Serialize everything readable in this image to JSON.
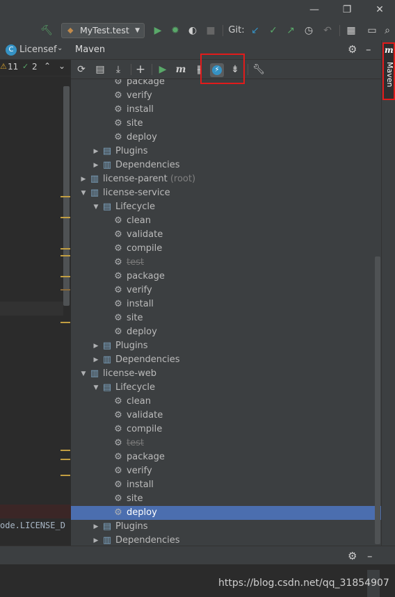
{
  "toolbar": {
    "run_config": "MyTest.test",
    "git_label": "Git:"
  },
  "editor_tab": {
    "label": "Licensef",
    "warnings": "11",
    "weak": "2"
  },
  "editor": {
    "code_fragment": "ode.LICENSE_D"
  },
  "maven": {
    "title": "Maven",
    "side_tab": "Maven",
    "tree": [
      {
        "label": "package",
        "type": "goal",
        "level": 3
      },
      {
        "label": "verify",
        "type": "goal",
        "level": 3
      },
      {
        "label": "install",
        "type": "goal",
        "level": 3
      },
      {
        "label": "site",
        "type": "goal",
        "level": 3
      },
      {
        "label": "deploy",
        "type": "goal",
        "level": 3
      },
      {
        "label": "Plugins",
        "type": "plugins",
        "level": 2
      },
      {
        "label": "Dependencies",
        "type": "deps",
        "level": 2
      },
      {
        "label": "license-parent",
        "suffix": " (root)",
        "type": "project",
        "level": 1
      },
      {
        "label": "license-service",
        "type": "project-open",
        "level": 1
      },
      {
        "label": "Lifecycle",
        "type": "lifecycle",
        "level": 2
      },
      {
        "label": "clean",
        "type": "goal",
        "level": 3
      },
      {
        "label": "validate",
        "type": "goal",
        "level": 3
      },
      {
        "label": "compile",
        "type": "goal",
        "level": 3
      },
      {
        "label": "test",
        "type": "goal-skip",
        "level": 3
      },
      {
        "label": "package",
        "type": "goal",
        "level": 3
      },
      {
        "label": "verify",
        "type": "goal",
        "level": 3
      },
      {
        "label": "install",
        "type": "goal",
        "level": 3
      },
      {
        "label": "site",
        "type": "goal",
        "level": 3
      },
      {
        "label": "deploy",
        "type": "goal",
        "level": 3
      },
      {
        "label": "Plugins",
        "type": "plugins",
        "level": 2
      },
      {
        "label": "Dependencies",
        "type": "deps",
        "level": 2
      },
      {
        "label": "license-web",
        "type": "project-open",
        "level": 1
      },
      {
        "label": "Lifecycle",
        "type": "lifecycle",
        "level": 2
      },
      {
        "label": "clean",
        "type": "goal",
        "level": 3
      },
      {
        "label": "validate",
        "type": "goal",
        "level": 3
      },
      {
        "label": "compile",
        "type": "goal",
        "level": 3
      },
      {
        "label": "test",
        "type": "goal-skip",
        "level": 3
      },
      {
        "label": "package",
        "type": "goal",
        "level": 3
      },
      {
        "label": "verify",
        "type": "goal",
        "level": 3
      },
      {
        "label": "install",
        "type": "goal",
        "level": 3
      },
      {
        "label": "site",
        "type": "goal",
        "level": 3
      },
      {
        "label": "deploy",
        "type": "goal",
        "level": 3,
        "selected": true
      },
      {
        "label": "Plugins",
        "type": "plugins",
        "level": 2
      },
      {
        "label": "Dependencies",
        "type": "deps",
        "level": 2
      }
    ]
  },
  "watermark": "https://blog.csdn.net/qq_31854907",
  "colors": {
    "highlight_box": "#e21b1b",
    "selection": "#4b6eaf",
    "run_green": "#59a869",
    "git_blue": "#3592c4"
  }
}
